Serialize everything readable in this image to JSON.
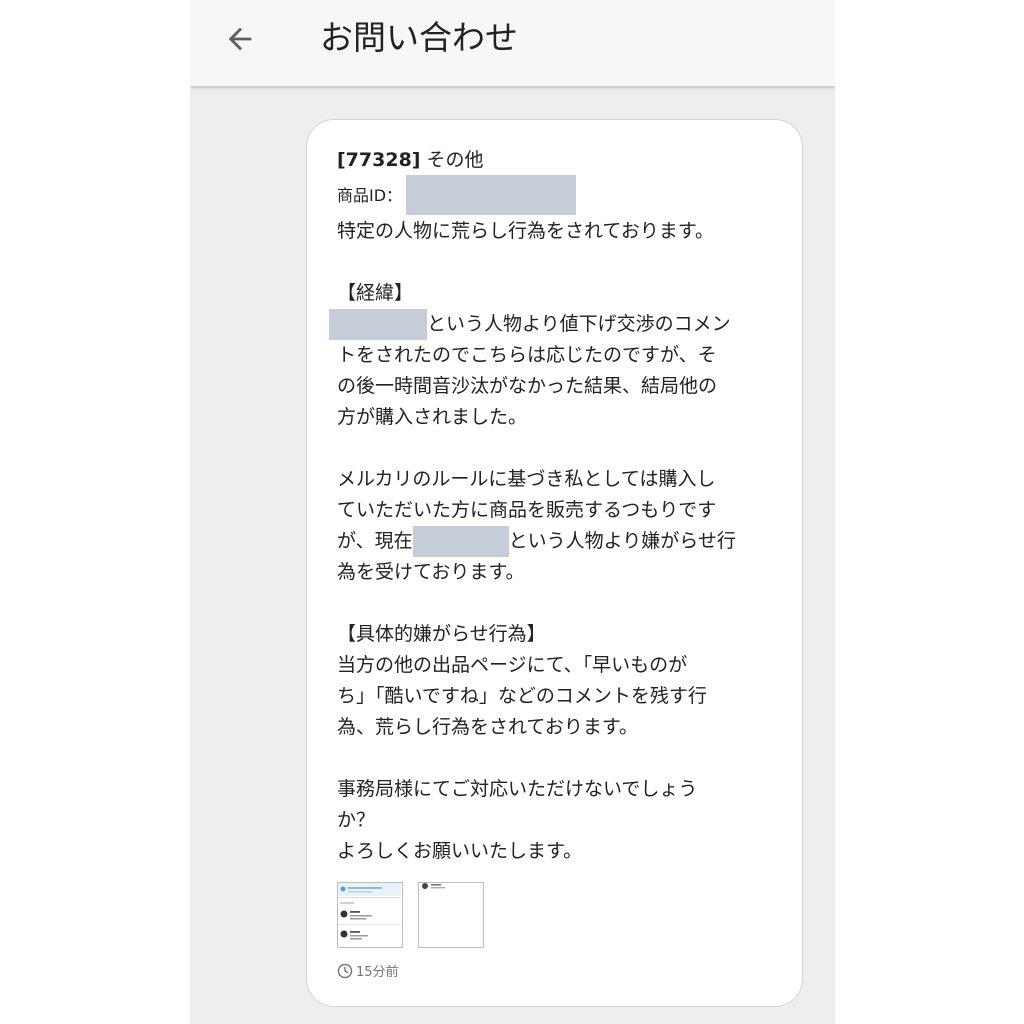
{
  "header": {
    "title": "お問い合わせ",
    "back_icon": "arrow-left-icon"
  },
  "message": {
    "id": "[77328]",
    "category": "その他",
    "product_id_label": "商品ID：",
    "lines": [
      "特定の人物に荒らし行為をされております。",
      "",
      "【経緯】",
      "という人物より値下げ交渉のコメン",
      "トをされたのでこちらは応じたのですが、そ",
      "の後一時間音沙汰がなかった結果、結局他の",
      "方が購入されました。",
      "",
      "メルカリのルールに基づき私としては購入し",
      "ていただいた方に商品を販売するつもりです",
      "が、現在",
      "という人物より嫌がらせ行",
      "為を受けております。",
      "",
      "【具体的嫌がらせ行為】",
      "当方の他の出品ページにて、「早いものが",
      "ち」「酷いですね」などのコメントを残す行",
      "為、荒らし行為をされております。",
      "",
      "事務局様にてご対応いただけないでしょう",
      "か？",
      "よろしくお願いいたします。"
    ],
    "timestamp": "15分前"
  },
  "attachments": [
    {
      "name": "attachment-thumbnail-1"
    },
    {
      "name": "attachment-thumbnail-2"
    }
  ],
  "colors": {
    "app_background": "#eeeeee",
    "appbar": "#f7f7f7",
    "card": "#ffffff",
    "redaction": "#c5ced8",
    "text": "#222222",
    "muted": "#757575"
  }
}
